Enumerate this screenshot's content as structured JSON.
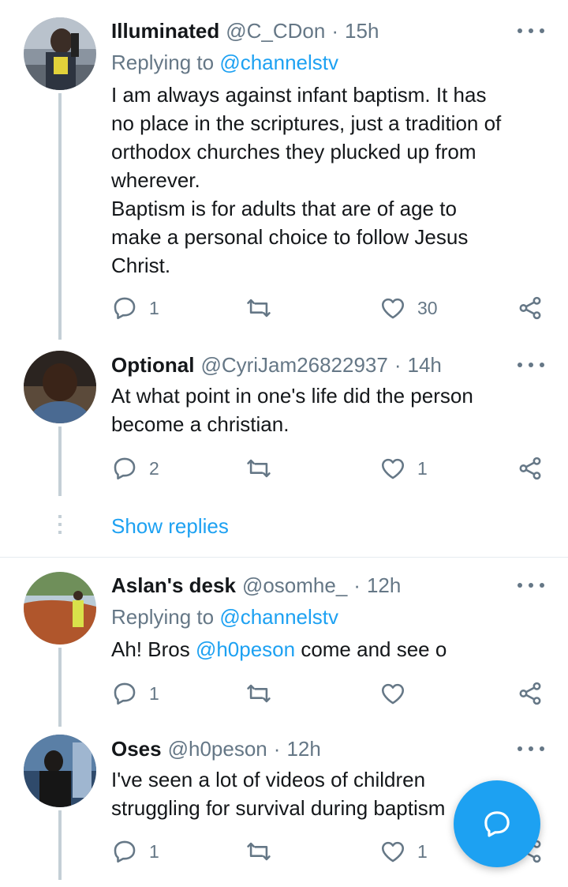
{
  "tweets": [
    {
      "name": "Illuminated",
      "handle": "@C_CDon",
      "time": "15h",
      "replying_label": "Replying to",
      "replying_to": "@channelstv",
      "text": "I am always against infant baptism. It has\nno place in the scriptures, just a tradition of\northodox churches they plucked up from\nwherever.\nBaptism is for adults that are of age to\nmake a personal choice to follow Jesus\nChrist.",
      "replies": "1",
      "retweets": "",
      "likes": "30"
    },
    {
      "name": "Optional",
      "handle": "@CyriJam26822937",
      "time": "14h",
      "text": "At what point in one's life did the person\nbecome a christian.",
      "replies": "2",
      "retweets": "",
      "likes": "1"
    },
    {
      "name": "Aslan's desk",
      "handle": "@osomhe_",
      "time": "12h",
      "replying_label": "Replying to",
      "replying_to": "@channelstv",
      "text_before": "Ah! Bros ",
      "text_mention": "@h0peson",
      "text_after": " come and see o",
      "replies": "1",
      "retweets": "",
      "likes": ""
    },
    {
      "name": "Oses",
      "handle": "@h0peson",
      "time": "12h",
      "text": "I've seen a lot of videos of children\nstruggling for survival during baptism",
      "replies": "1",
      "retweets": "",
      "likes": "1"
    }
  ],
  "show_replies": "Show replies",
  "separator_dot": "·",
  "colors": {
    "accent": "#1da1f2",
    "muted": "#657786",
    "thread": "#c4cfd6"
  },
  "icons": [
    "reply-icon",
    "retweet-icon",
    "like-icon",
    "share-icon",
    "more-icon",
    "compose-reply-icon"
  ]
}
